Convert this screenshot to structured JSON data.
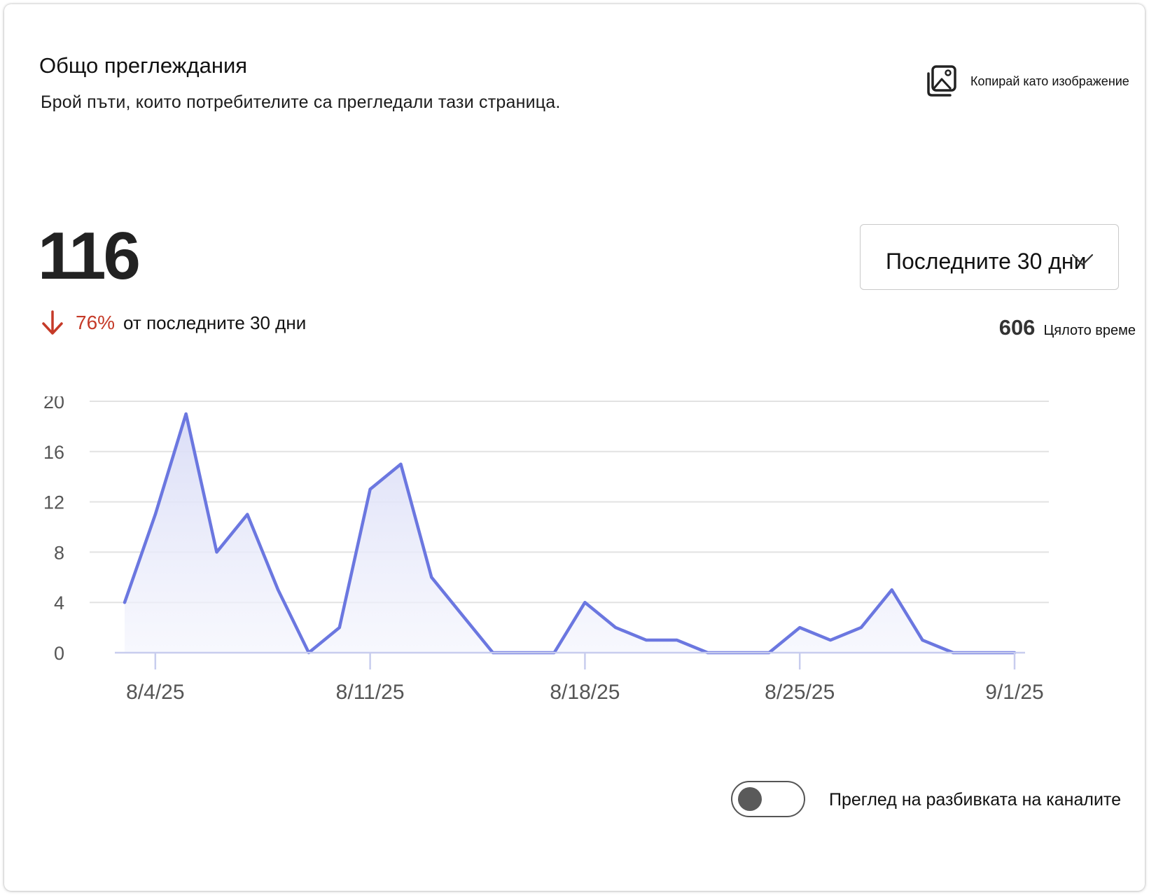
{
  "card": {
    "title": "Общо преглеждания",
    "subtitle": "Брой пъти, които потребителите са прегледали тази страница.",
    "copy_label": "Копирай като изображение"
  },
  "summary": {
    "total": "116",
    "change_percent": "76%",
    "change_direction": "down",
    "change_text": "от последните 30 дни",
    "change_color": "#c53a28"
  },
  "range_select": {
    "selected": "Последните 30 дни"
  },
  "all_time": {
    "value": "606",
    "label": "Цялото време"
  },
  "chart_data": {
    "type": "area",
    "x": [
      "8/3/25",
      "8/4/25",
      "8/5/25",
      "8/6/25",
      "8/7/25",
      "8/8/25",
      "8/9/25",
      "8/10/25",
      "8/11/25",
      "8/12/25",
      "8/13/25",
      "8/14/25",
      "8/15/25",
      "8/16/25",
      "8/17/25",
      "8/18/25",
      "8/19/25",
      "8/20/25",
      "8/21/25",
      "8/22/25",
      "8/23/25",
      "8/24/25",
      "8/25/25",
      "8/26/25",
      "8/27/25",
      "8/28/25",
      "8/29/25",
      "8/30/25",
      "8/31/25",
      "9/1/25"
    ],
    "series": [
      {
        "values": [
          4,
          11,
          19,
          8,
          11,
          5,
          0,
          2,
          13,
          15,
          6,
          3,
          0,
          0,
          0,
          4,
          2,
          1,
          1,
          0,
          0,
          0,
          2,
          1,
          2,
          5,
          1,
          0,
          0,
          0
        ]
      }
    ],
    "x_tick_labels": [
      "8/4/25",
      "8/11/25",
      "8/18/25",
      "8/25/25",
      "9/1/25"
    ],
    "y_ticks": [
      0,
      4,
      8,
      12,
      16,
      20
    ],
    "ylim": [
      0,
      20
    ],
    "grid": true,
    "line_color": "#6b77e0",
    "fill_color": "#e3e5f8"
  },
  "breakdown_toggle": {
    "label": "Преглед на разбивката на каналите",
    "on": false
  }
}
